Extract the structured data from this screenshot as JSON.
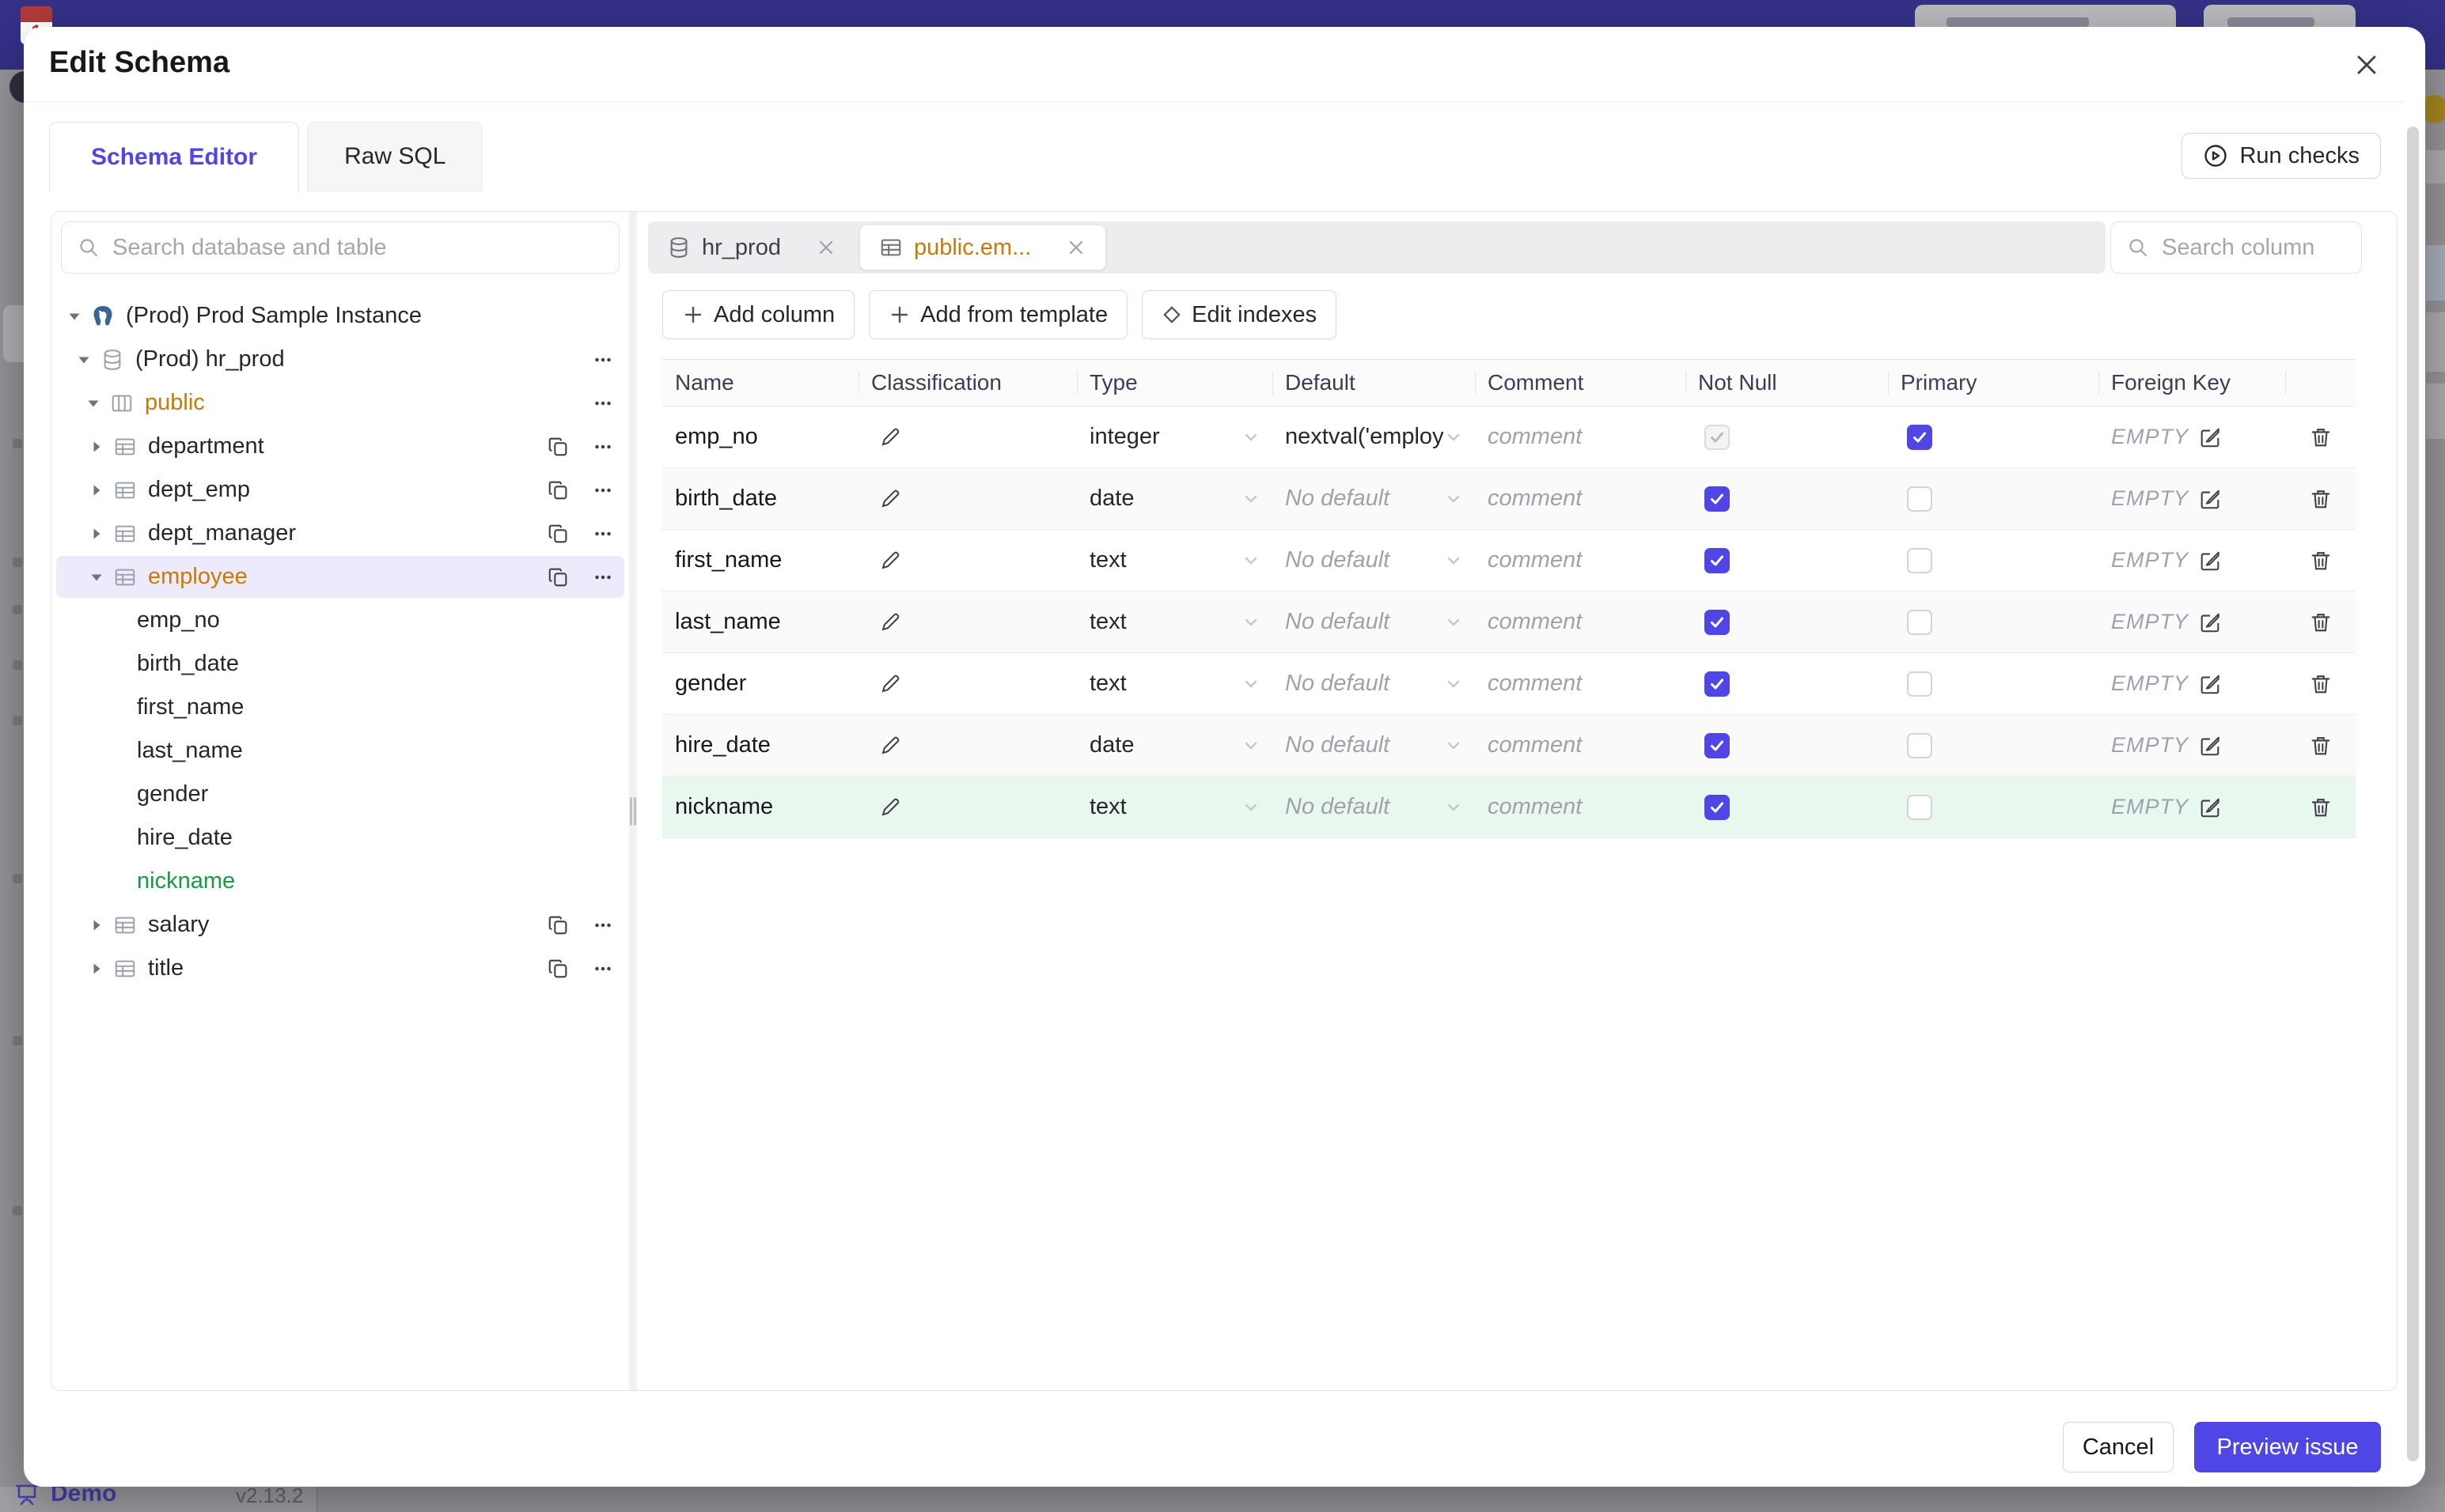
{
  "colors": {
    "accent": "#4f46e5",
    "topbar": "#343188",
    "changed_orange": "#c97a06",
    "new_green": "#169a47",
    "new_row_bg": "#e9f8ef",
    "selected_bg": "#eceafb"
  },
  "backdrop": {
    "demo_label": "Demo",
    "version": "v2.13.2"
  },
  "modal": {
    "title": "Edit Schema",
    "tabs": [
      {
        "label": "Schema Editor"
      },
      {
        "label": "Raw SQL"
      }
    ],
    "run_checks_label": "Run checks"
  },
  "left_panel": {
    "search_placeholder": "Search database and table",
    "tree": [
      {
        "label": "(Prod) Prod Sample Instance",
        "level": 0,
        "arrow": "down",
        "icon": "postgres",
        "actions": []
      },
      {
        "label": "(Prod) hr_prod",
        "level": 1,
        "arrow": "down",
        "icon": "database",
        "actions": [
          "more"
        ]
      },
      {
        "label": "public",
        "level": 2,
        "arrow": "down",
        "icon": "schema",
        "color": "orange",
        "actions": [
          "more"
        ]
      },
      {
        "label": "department",
        "level": 3,
        "arrow": "right",
        "icon": "table",
        "actions": [
          "copy",
          "more"
        ]
      },
      {
        "label": "dept_emp",
        "level": 3,
        "arrow": "right",
        "icon": "table",
        "actions": [
          "copy",
          "more"
        ]
      },
      {
        "label": "dept_manager",
        "level": 3,
        "arrow": "right",
        "icon": "table",
        "actions": [
          "copy",
          "more"
        ]
      },
      {
        "label": "employee",
        "level": 3,
        "arrow": "down",
        "icon": "table",
        "color": "orange",
        "selected": true,
        "actions": [
          "copy",
          "more"
        ]
      },
      {
        "label": "emp_no",
        "column": true
      },
      {
        "label": "birth_date",
        "column": true
      },
      {
        "label": "first_name",
        "column": true
      },
      {
        "label": "last_name",
        "column": true
      },
      {
        "label": "gender",
        "column": true
      },
      {
        "label": "hire_date",
        "column": true
      },
      {
        "label": "nickname",
        "column": true,
        "color": "green"
      },
      {
        "label": "salary",
        "level": 3,
        "arrow": "right",
        "icon": "table",
        "actions": [
          "copy",
          "more"
        ]
      },
      {
        "label": "title",
        "level": 3,
        "arrow": "right",
        "icon": "table",
        "actions": [
          "copy",
          "more"
        ]
      }
    ]
  },
  "editor": {
    "tabs": [
      {
        "label": "hr_prod",
        "icon": "database",
        "active": false
      },
      {
        "label": "public.em...",
        "icon": "table",
        "active": true
      }
    ],
    "search_placeholder": "Search column",
    "toolbar": [
      {
        "label": "Add column",
        "icon": "plus"
      },
      {
        "label": "Add from template",
        "icon": "plus"
      },
      {
        "label": "Edit indexes",
        "icon": "diamond"
      }
    ],
    "table": {
      "headers": [
        "Name",
        "Classification",
        "Type",
        "Default",
        "Comment",
        "Not Null",
        "Primary",
        "Foreign Key"
      ],
      "comment_placeholder": "comment",
      "foreign_key_empty": "EMPTY",
      "rows": [
        {
          "name": "emp_no",
          "type": "integer",
          "default": "nextval('employ",
          "default_is_placeholder": false,
          "not_null": true,
          "not_null_disabled": true,
          "primary": true,
          "is_new": false
        },
        {
          "name": "birth_date",
          "type": "date",
          "default": "No default",
          "default_is_placeholder": true,
          "not_null": true,
          "not_null_disabled": false,
          "primary": false,
          "is_new": false
        },
        {
          "name": "first_name",
          "type": "text",
          "default": "No default",
          "default_is_placeholder": true,
          "not_null": true,
          "not_null_disabled": false,
          "primary": false,
          "is_new": false
        },
        {
          "name": "last_name",
          "type": "text",
          "default": "No default",
          "default_is_placeholder": true,
          "not_null": true,
          "not_null_disabled": false,
          "primary": false,
          "is_new": false
        },
        {
          "name": "gender",
          "type": "text",
          "default": "No default",
          "default_is_placeholder": true,
          "not_null": true,
          "not_null_disabled": false,
          "primary": false,
          "is_new": false
        },
        {
          "name": "hire_date",
          "type": "date",
          "default": "No default",
          "default_is_placeholder": true,
          "not_null": true,
          "not_null_disabled": false,
          "primary": false,
          "is_new": false
        },
        {
          "name": "nickname",
          "type": "text",
          "default": "No default",
          "default_is_placeholder": true,
          "not_null": true,
          "not_null_disabled": false,
          "primary": false,
          "is_new": true
        }
      ]
    }
  },
  "footer": {
    "cancel_label": "Cancel",
    "primary_label": "Preview issue"
  }
}
